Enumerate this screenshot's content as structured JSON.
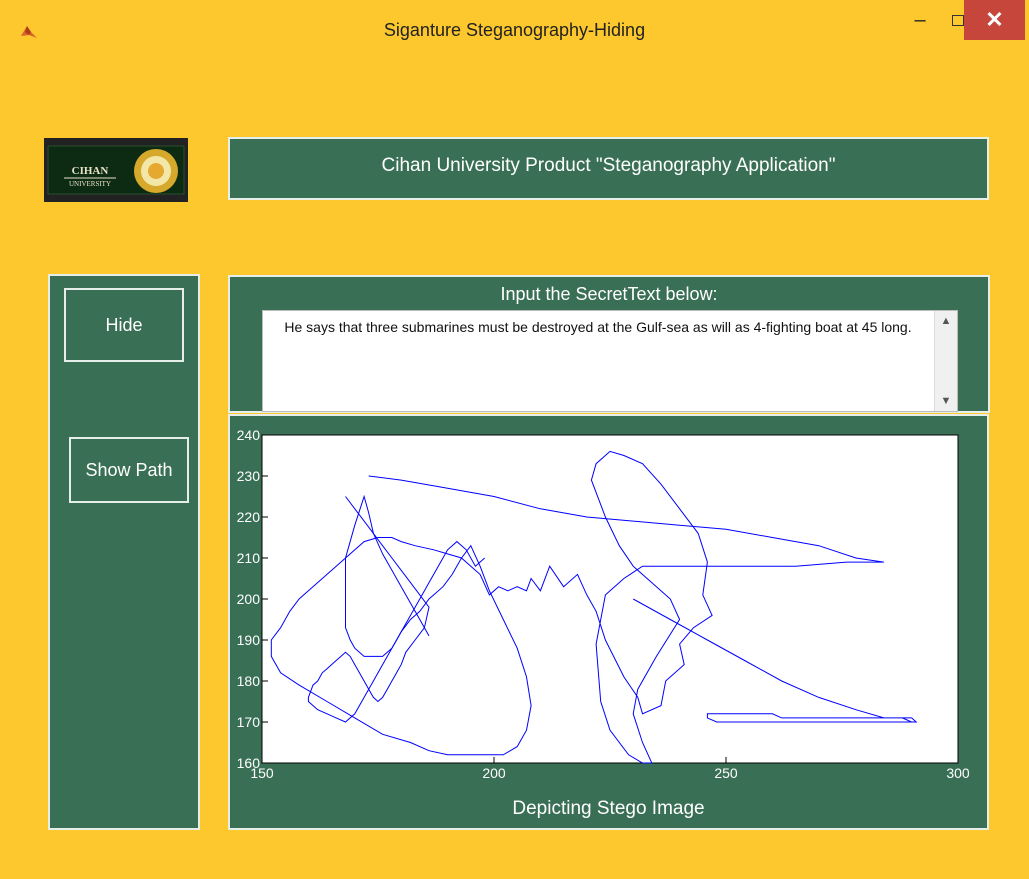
{
  "window": {
    "title": "Siganture Steganography-Hiding",
    "minimize": "–",
    "maximize": "☐",
    "close": "✕"
  },
  "logo": {
    "text_top": "CIHAN",
    "text_bottom": "UNIVERSITY"
  },
  "header": {
    "title": "Cihan University Product \"Steganography Application\""
  },
  "buttons": {
    "hide": "Hide",
    "show_path": "Show Path"
  },
  "input": {
    "label": "Input the SecretText below:",
    "value": "He says that three submarines must be destroyed  at the Gulf-sea as will as 4-fighting boat at 45 long."
  },
  "colors": {
    "background": "#fcc82e",
    "panel": "#396f55",
    "line": "#0000ff",
    "close": "#c7463b"
  },
  "chart_data": {
    "type": "line",
    "title": "",
    "xlabel": "Depicting Stego Image",
    "ylabel": "",
    "xlim": [
      150,
      300
    ],
    "ylim": [
      160,
      240
    ],
    "xticks": [
      150,
      200,
      250,
      300
    ],
    "yticks": [
      160,
      170,
      180,
      190,
      200,
      210,
      220,
      230,
      240
    ],
    "grid": false,
    "series": [
      {
        "x": [
          173,
          180,
          190,
          200,
          210,
          220,
          230,
          240,
          250,
          260,
          270,
          278,
          284,
          276,
          265,
          250,
          240,
          232,
          228,
          224,
          222,
          223,
          225,
          229,
          232,
          234,
          232,
          230,
          231,
          235,
          240,
          238,
          233,
          230,
          227,
          224,
          221,
          222,
          225,
          228,
          232,
          236,
          240,
          244,
          246,
          245,
          247,
          243,
          240,
          241,
          237,
          236,
          232,
          231,
          228,
          224,
          222,
          220,
          218,
          215,
          212,
          210,
          208,
          207,
          205,
          203,
          201,
          199,
          197,
          195,
          193,
          190,
          187,
          183,
          180,
          178,
          176,
          175
        ],
        "y": [
          230,
          229,
          227,
          225,
          222,
          220,
          219,
          218,
          217,
          215,
          213,
          210,
          209,
          209,
          208,
          208,
          208,
          208,
          205,
          201,
          189,
          175,
          168,
          162,
          160,
          160,
          165,
          172,
          178,
          186,
          195,
          200,
          205,
          208,
          213,
          220,
          229,
          233,
          236,
          235,
          233,
          228,
          222,
          216,
          209,
          201,
          196,
          193,
          189,
          184,
          180,
          174,
          172,
          176,
          181,
          190,
          197,
          201,
          206,
          203,
          208,
          202,
          205,
          202,
          203,
          202,
          203,
          201,
          206,
          208,
          210,
          211,
          212,
          213,
          214,
          215,
          215,
          215
        ]
      },
      {
        "x": [
          175,
          172,
          169,
          166,
          163,
          160,
          158,
          156,
          154,
          152,
          152,
          154,
          158,
          164,
          170,
          176,
          182,
          186,
          190,
          194,
          198,
          202,
          205,
          207,
          208,
          207,
          205,
          202,
          199,
          197,
          195,
          193,
          191,
          189,
          186,
          184,
          182,
          180,
          179,
          178,
          177,
          176,
          175,
          174,
          173,
          172,
          171,
          170,
          169,
          168,
          168,
          170,
          172,
          173,
          174,
          176,
          178,
          180,
          182,
          184,
          186
        ],
        "y": [
          215,
          214,
          211,
          208,
          205,
          202,
          200,
          197,
          193,
          190,
          186,
          182,
          179,
          175,
          171,
          167,
          165,
          163,
          162,
          162,
          162,
          162,
          164,
          168,
          174,
          181,
          188,
          195,
          202,
          208,
          213,
          210,
          206,
          203,
          200,
          197,
          195,
          192,
          190,
          188,
          187,
          186,
          186,
          186,
          186,
          186,
          187,
          188,
          190,
          193,
          210,
          218,
          225,
          221,
          216,
          211,
          207,
          203,
          199,
          195,
          191
        ]
      },
      {
        "x": [
          168,
          170,
          172,
          174,
          176,
          178,
          180,
          182,
          184,
          186,
          185,
          183,
          181,
          180,
          179,
          178,
          177,
          176,
          175,
          174,
          173,
          172,
          171,
          170,
          169,
          168,
          167,
          166,
          165,
          164,
          163,
          162,
          161,
          160,
          160,
          162,
          164,
          166,
          168,
          170,
          172,
          174,
          176,
          178,
          180,
          182,
          184,
          186,
          188,
          190,
          192,
          194,
          196,
          198
        ],
        "y": [
          225,
          222,
          219,
          216,
          213,
          210,
          207,
          204,
          201,
          198,
          193,
          190,
          187,
          184,
          182,
          180,
          178,
          176,
          175,
          176,
          178,
          180,
          182,
          184,
          186,
          187,
          186,
          185,
          184,
          183,
          182,
          180,
          179,
          176,
          175,
          173,
          172,
          171,
          170,
          172,
          176,
          180,
          184,
          188,
          192,
          196,
          200,
          204,
          208,
          212,
          214,
          212,
          208,
          210
        ]
      },
      {
        "x": [
          230,
          238,
          246,
          254,
          262,
          270,
          278,
          284,
          290,
          291,
          286,
          280,
          274,
          268,
          262,
          256,
          250,
          248,
          246,
          246,
          248,
          250,
          252,
          254,
          256,
          258,
          260,
          262,
          264,
          266,
          268,
          270,
          272,
          274,
          276,
          278,
          280,
          282,
          284,
          286,
          288,
          290,
          291
        ],
        "y": [
          200,
          195,
          190,
          185,
          180,
          176,
          173,
          171,
          171,
          170,
          170,
          170,
          170,
          170,
          170,
          170,
          170,
          170,
          171,
          172,
          172,
          172,
          172,
          172,
          172,
          172,
          172,
          171,
          171,
          171,
          171,
          171,
          171,
          171,
          171,
          171,
          171,
          171,
          171,
          171,
          171,
          170,
          170
        ]
      }
    ]
  }
}
